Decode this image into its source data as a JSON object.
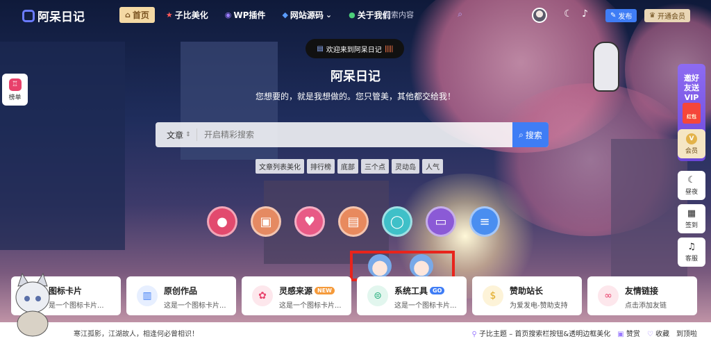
{
  "header": {
    "logo_text": "阿呆日记",
    "nav": [
      {
        "icon": "home-icon",
        "glyph": "⌂",
        "label": "首页",
        "active": true
      },
      {
        "icon": "star-icon",
        "glyph": "★",
        "label": "子比美化"
      },
      {
        "icon": "wordpress-icon",
        "glyph": "◉",
        "label": "WP插件"
      },
      {
        "icon": "code-icon",
        "glyph": "◆",
        "label": "网站源码",
        "dropdown": "⌄"
      },
      {
        "icon": "info-icon",
        "glyph": "●",
        "label": "关于我们"
      }
    ],
    "search_placeholder": "搜索内容",
    "publish_label": "发布",
    "vip_label": "开通会员"
  },
  "hero": {
    "welcome": "欢迎来到阿呆日记",
    "title": "阿呆日记",
    "subtitle": "您想要的，就是我想做的。您只管美，其他都交给我！",
    "search": {
      "select_label": "文章",
      "placeholder": "开启精彩搜索",
      "button_label": "搜索"
    },
    "tags": [
      "文章列表美化",
      "排行榜",
      "底部",
      "三个点",
      "灵动岛",
      "人气"
    ]
  },
  "shortcuts": [
    {
      "icon": "game-icon",
      "color": "#e24a6e",
      "glyph": "●"
    },
    {
      "icon": "gift-icon",
      "color": "#e58a62",
      "glyph": "▣"
    },
    {
      "icon": "heart-icon",
      "color": "#e85a86",
      "glyph": "♥"
    },
    {
      "icon": "image-icon",
      "color": "#e88a5e",
      "glyph": "▤"
    },
    {
      "icon": "chat-icon",
      "color": "#3fc0c8",
      "glyph": "◯"
    },
    {
      "icon": "card-icon",
      "color": "#8b5ad6",
      "glyph": "▭"
    },
    {
      "icon": "doc-icon",
      "color": "#4a8ef0",
      "glyph": "≡"
    }
  ],
  "cards": [
    {
      "icon": "flag-icon",
      "icon_color": "#3f7df5",
      "icon_bg": "#e7efff",
      "glyph": "⚑",
      "title": "图标卡片",
      "desc": "是一个图标卡片..."
    },
    {
      "icon": "building-icon",
      "icon_color": "#3f7df5",
      "icon_bg": "#e7efff",
      "glyph": "▥",
      "title": "原创作品",
      "desc": "这是一个图标卡片..."
    },
    {
      "icon": "sparkle-icon",
      "icon_color": "#e8416b",
      "icon_bg": "#fde7ec",
      "glyph": "✿",
      "title": "灵感来源",
      "badge": "NEW",
      "badge_color": "#f59a3a",
      "desc": "这是一个图标卡片..."
    },
    {
      "icon": "tool-icon",
      "icon_color": "#2bb07f",
      "icon_bg": "#e2f6ee",
      "glyph": "⊜",
      "title": "系统工具",
      "badge": "GO",
      "badge_color": "#3f7df5",
      "desc": "这是一个图标卡片..."
    },
    {
      "icon": "coin-icon",
      "icon_color": "#e0a820",
      "icon_bg": "#fdf3d8",
      "glyph": "$",
      "title": "赞助站长",
      "desc": "为爱发电-赞助支持"
    },
    {
      "icon": "link-icon",
      "icon_color": "#e8416b",
      "icon_bg": "#fde7ec",
      "glyph": "∞",
      "title": "友情链接",
      "desc": "点击添加友链"
    }
  ],
  "footer": {
    "text": "寒江孤影，江湖故人，相逢何必曾相识！",
    "links": [
      "子比主题 – 首页搜索栏按钮&透明边框美化",
      "赞赏",
      "收藏",
      "到顶啦"
    ]
  },
  "left_float": {
    "label": "榜单"
  },
  "right_bar": {
    "invite": "邀好友送VIP",
    "envelope": "红包",
    "vip": "会员",
    "items": [
      {
        "icon": "moon-icon",
        "glyph": "☾",
        "label": "昼夜"
      },
      {
        "icon": "calendar-icon",
        "glyph": "▦",
        "label": "签到"
      },
      {
        "icon": "headset-icon",
        "glyph": "♫",
        "label": "客服"
      }
    ]
  }
}
